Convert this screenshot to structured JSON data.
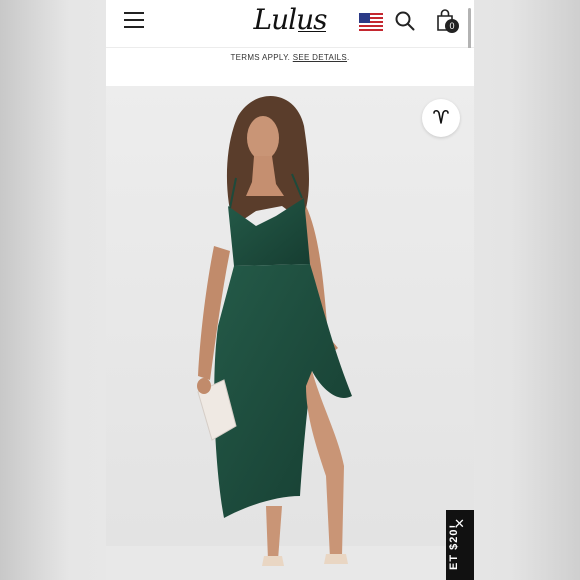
{
  "brand": {
    "name": "Lulus"
  },
  "cart": {
    "count": "0"
  },
  "promo": {
    "terms_text": "TERMS APPLY.",
    "link_text": "SEE DETAILS",
    "period": "."
  },
  "promo_tab": {
    "text": "ET $20!"
  },
  "icons": {
    "menu": "hamburger-menu-icon",
    "flag": "us-flag-icon",
    "search": "search-icon",
    "bag": "shopping-bag-icon",
    "badge": "heart-v-icon",
    "close": "close-icon"
  },
  "colors": {
    "dress": "#1e4a3b",
    "header_text": "#111111",
    "promo_tab": "#111111"
  }
}
